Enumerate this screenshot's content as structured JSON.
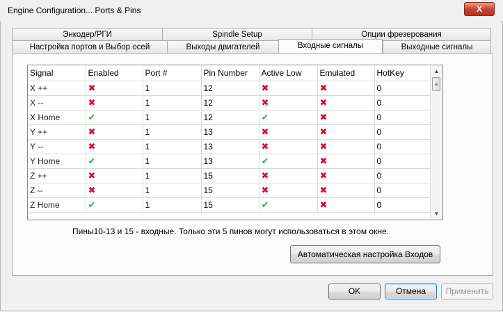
{
  "window": {
    "title": "Engine Configuration... Ports & Pins",
    "close_label": "X"
  },
  "tabs": {
    "row1": [
      "Энкодер/РГИ",
      "Spindle Setup",
      "Опции фрезерования"
    ],
    "row2": [
      "Настройка портов и Выбор осей",
      "Выходы двигателей",
      "Входные сигналы",
      "Выходные сигналы"
    ],
    "active": "Входные сигналы"
  },
  "table": {
    "columns": [
      "Signal",
      "Enabled",
      "Port #",
      "Pin Number",
      "Active Low",
      "Emulated",
      "HotKey"
    ],
    "rows": [
      {
        "signal": "X ++",
        "enabled": false,
        "port": "1",
        "pin": "12",
        "active_low": false,
        "emulated": false,
        "hotkey": "0"
      },
      {
        "signal": "X --",
        "enabled": false,
        "port": "1",
        "pin": "12",
        "active_low": false,
        "emulated": false,
        "hotkey": "0"
      },
      {
        "signal": "X Home",
        "enabled": true,
        "port": "1",
        "pin": "12",
        "active_low": true,
        "emulated": false,
        "hotkey": "0"
      },
      {
        "signal": "Y ++",
        "enabled": false,
        "port": "1",
        "pin": "13",
        "active_low": false,
        "emulated": false,
        "hotkey": "0"
      },
      {
        "signal": "Y --",
        "enabled": false,
        "port": "1",
        "pin": "13",
        "active_low": false,
        "emulated": false,
        "hotkey": "0"
      },
      {
        "signal": "Y Home",
        "enabled": true,
        "port": "1",
        "pin": "13",
        "active_low": true,
        "emulated": false,
        "hotkey": "0"
      },
      {
        "signal": "Z ++",
        "enabled": false,
        "port": "1",
        "pin": "15",
        "active_low": false,
        "emulated": false,
        "hotkey": "0"
      },
      {
        "signal": "Z --",
        "enabled": false,
        "port": "1",
        "pin": "15",
        "active_low": false,
        "emulated": false,
        "hotkey": "0"
      },
      {
        "signal": "Z Home",
        "enabled": true,
        "port": "1",
        "pin": "15",
        "active_low": true,
        "emulated": false,
        "hotkey": "0"
      }
    ]
  },
  "icons": {
    "enabled_true": "green-check-icon",
    "enabled_false": "red-x-icon"
  },
  "colors": {
    "check": "#2db82a",
    "cross": "#d0102a",
    "close_button": "#c4482e"
  },
  "hint": "Пины10-13 и 15 - входные. Только эти 5 пинов могут использоваться в этом окне.",
  "buttons": {
    "auto_config": "Автоматическая настройка Входов",
    "ok": "OK",
    "cancel": "Отмена",
    "apply": "Применить"
  }
}
